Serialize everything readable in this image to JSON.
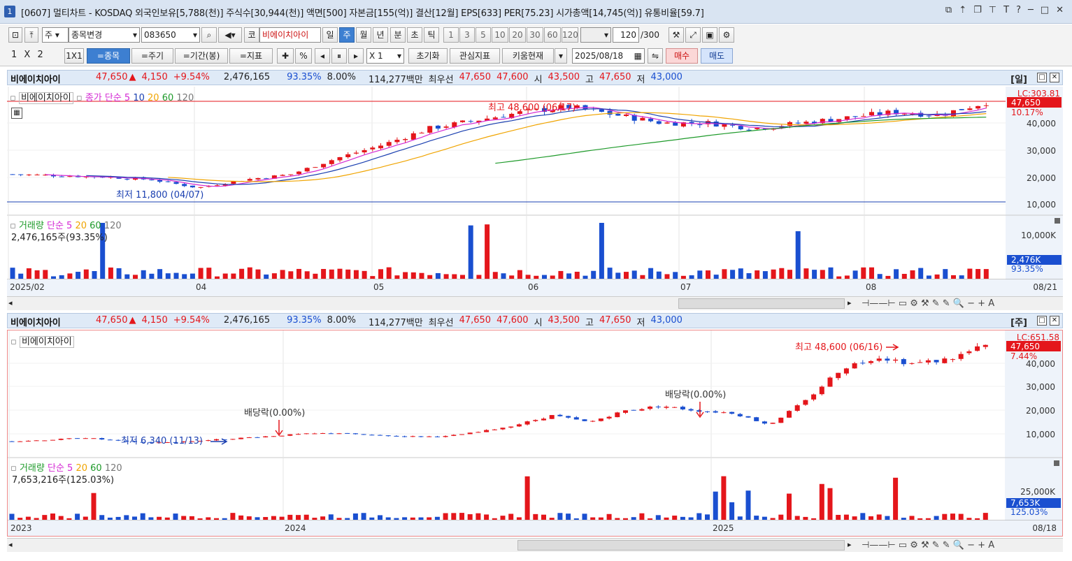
{
  "app": {
    "badge": "1",
    "title": "[0607] 멀티차트 - KOSDAQ 외국인보유[5,788(천)] 주식수[30,944(천)] 액면[500] 자본금[155(억)] 결산[12월] EPS[633] PER[75.23] 시가총액[14,745(억)] 유통비율[59.7]",
    "title_buttons": [
      "⧉",
      "⬆",
      "⧉",
      "⬍",
      "T",
      "?",
      "─",
      "□",
      "✕"
    ]
  },
  "toolbar1": {
    "market_select": "주",
    "change_item_label": "종목변경",
    "code_value": "083650",
    "market_badge": "코",
    "item_name": "비에이치아이",
    "period_tabs": [
      "일",
      "주",
      "월",
      "년",
      "분",
      "초",
      "틱"
    ],
    "selected_period": "주",
    "interval_buttons": [
      "1",
      "3",
      "5",
      "10",
      "20",
      "30",
      "60",
      "120"
    ],
    "count_value": "120",
    "count_total": "/300"
  },
  "toolbar2": {
    "layout_label": "1 X 2",
    "single_label": "1X1",
    "btn_item": "=종목",
    "btn_period": "=주기",
    "btn_range": "=기간(봉)",
    "btn_indicator": "=지표",
    "percent_label": "%",
    "multiplier": "X 1",
    "reset_label": "초기화",
    "watch_label": "관심지표",
    "kiwoom_label": "키움현재",
    "date_value": "2025/08/18",
    "buy_label": "매수",
    "sell_label": "매도"
  },
  "quote": {
    "name": "비에이치아이",
    "price": "47,650",
    "arrow": "▲",
    "change": "4,150",
    "change_pct": "+9.54%",
    "volume": "2,476,165",
    "vol_ratio": "93.35%",
    "turnover": "8.00%",
    "amount": "114,277백만",
    "best_label": "최우선",
    "ask": "47,650",
    "bid": "47,600",
    "open_label": "시",
    "open": "43,500",
    "high_label": "고",
    "high": "47,650",
    "low_label": "저",
    "low": "43,000"
  },
  "top_chart": {
    "period_label": "[일]",
    "item_label": "비에이치아이",
    "legend_price": "종가 단순 5",
    "legend_ma": [
      "10",
      "20",
      "60",
      "120"
    ],
    "high_annot": "최고 48,600 (06/17)",
    "low_annot": "최저 11,800 (04/07)",
    "axis_top_label": "LC:303.81",
    "price_label": "47,650",
    "pct_label": "10.17%",
    "yticks": [
      "40,000",
      "30,000",
      "20,000",
      "10,000"
    ],
    "vol_legend": "거래량",
    "vol_legend_ma": "단순 5",
    "vol_ma": [
      "20",
      "60",
      "120"
    ],
    "vol_value": "2,476,165주(93.35%)",
    "vol_tick": "10,000K",
    "vol_current": "2,476K",
    "vol_pct": "93.35%",
    "xticks": [
      "2025/02",
      "04",
      "05",
      "06",
      "07",
      "08"
    ],
    "last_date": "08/21"
  },
  "bottom_chart": {
    "period_label": "[주]",
    "item_label": "비에이치아이",
    "high_annot": "최고 48,600 (06/16)",
    "low_annot": "최저 6,340 (11/13)",
    "dividend1": "배당락(0.00%)",
    "dividend2": "배당락(0.00%)",
    "axis_top_label": "LC:651.58",
    "price_label": "47,650",
    "pct_label": "7.44%",
    "yticks": [
      "40,000",
      "30,000",
      "20,000",
      "10,000"
    ],
    "vol_legend": "거래량",
    "vol_legend_ma": "단순 5",
    "vol_ma": [
      "20",
      "60",
      "120"
    ],
    "vol_value": "7,653,216주(125.03%)",
    "vol_tick": "25,000K",
    "vol_current": "7,653K",
    "vol_pct": "125.03%",
    "xticks": [
      "2023",
      "2024",
      "2025"
    ],
    "last_date": "08/18"
  },
  "scroll_tools": "⊣——⊢  ▭ ⚙ ⚒ ✎ ✎ 🔍 − + A",
  "colors": {
    "up": "#e4161b",
    "down": "#1a4fd0",
    "ma5": "#d42ad4",
    "ma10": "#1a3fb0",
    "ma20": "#f0a400",
    "ma60": "#1e9a2a",
    "ma120": "#555555"
  }
}
